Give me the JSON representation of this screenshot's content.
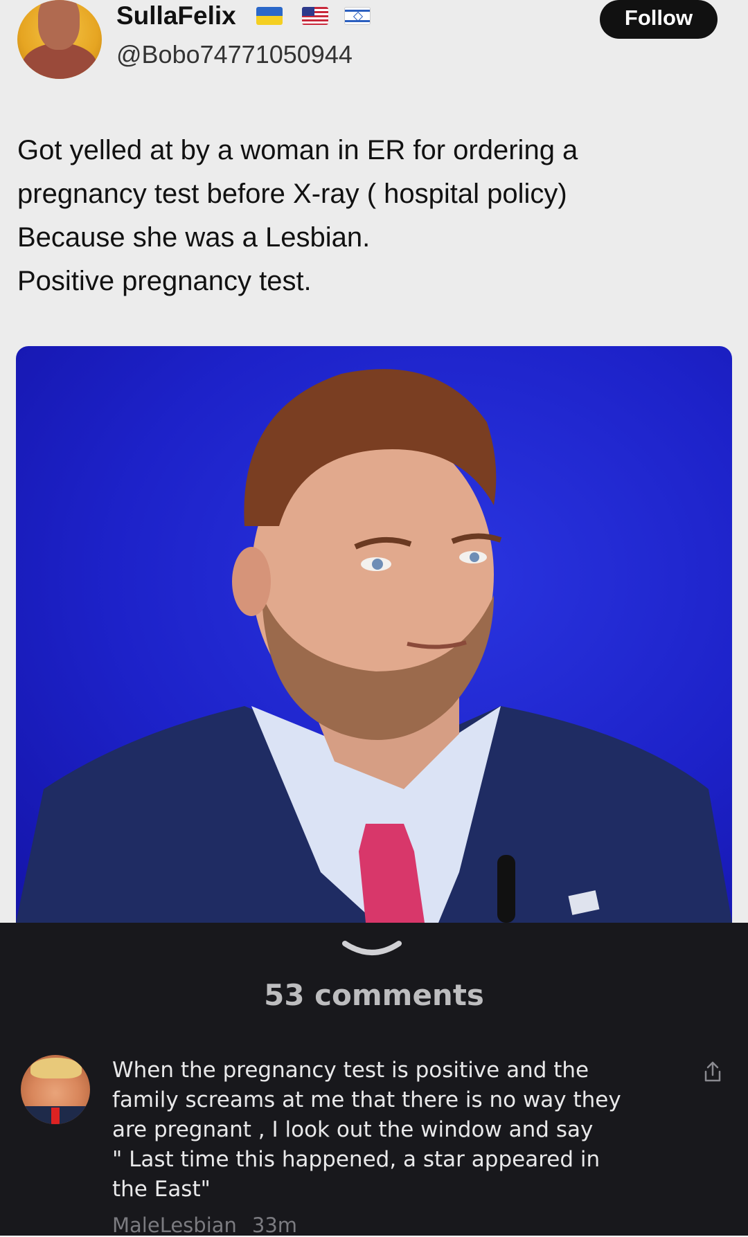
{
  "tweet": {
    "display_name": "SullaFelix",
    "flags": [
      "ukraine-flag-icon",
      "us-flag-icon",
      "israel-flag-icon"
    ],
    "handle": "@Bobo74771050944",
    "follow_label": "Follow",
    "text_lines": [
      "Got yelled at by a woman in ER for ordering a",
      "pregnancy test before X-ray ( hospital policy)",
      "Because she was a Lesbian.",
      "Positive pregnancy test."
    ],
    "media": "photo-man-in-suit-blue-background"
  },
  "comments_panel": {
    "handle_icon": "chevron-down-icon",
    "title": "53 comments",
    "comment": {
      "text_lines": [
        "When the pregnancy test is positive and the",
        "family screams at me that there is no way they",
        "are pregnant , I look out the window and say",
        "\" Last time this happened, a star appeared in",
        "the East\""
      ],
      "author": "MaleLesbian",
      "time": "33m",
      "share_icon": "share-icon"
    }
  },
  "colors": {
    "tweet_background": "#ececec",
    "follow_button": "#111111",
    "comments_background": "#18181c",
    "media_background": "#1d22c9"
  }
}
